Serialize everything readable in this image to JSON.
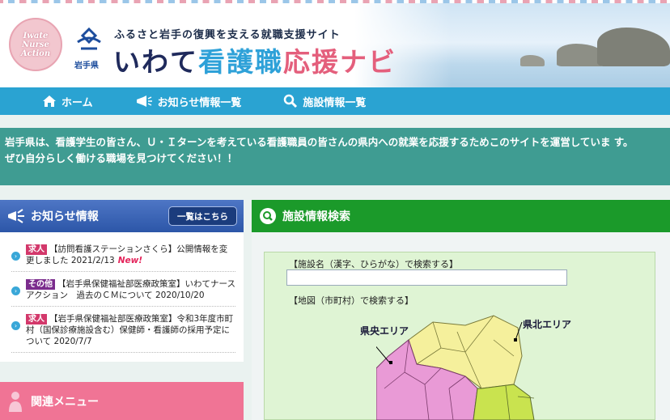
{
  "header": {
    "badge_text": "Iwate\nNurse\nAction",
    "pref_name": "岩手県",
    "tagline": "ふるさと岩手の復興を支える就職支援サイト",
    "title_part1": "いわて",
    "title_part2": "看護職",
    "title_part3": "応援ナビ"
  },
  "nav": {
    "home": "ホーム",
    "news_list": "お知らせ情報一覧",
    "facility_list": "施設情報一覧"
  },
  "intro": {
    "line1": "岩手県は、看護学生の皆さん、Ｕ・Ｉターンを考えている看護職員の皆さんの県内への就業を応援するためこのサイトを運営していま す。",
    "line2": "ぜひ自分らしく働ける職場を見つけてください！！"
  },
  "news": {
    "heading": "お知らせ情報",
    "more": "一覧はこちら",
    "items": [
      {
        "tag": "求人",
        "text": "【訪問看護ステーションさくら】公開情報を変更しました 2021/2/13",
        "new": "New!"
      },
      {
        "tag": "その他",
        "text": "【岩手県保健福祉部医療政策室】いわてナースアクション　過去のＣＭについて 2020/10/20"
      },
      {
        "tag": "求人",
        "text": "【岩手県保健福祉部医療政策室】令和3年度市町村（国保診療施設含む）保健師・看護師の採用予定について 2020/7/7"
      }
    ]
  },
  "related": {
    "heading": "関連メニュー"
  },
  "facility_search": {
    "heading": "施設情報検索",
    "name_label": "【施設名（漢字、ひらがな）で検索する】",
    "name_value": "",
    "map_label": "【地図（市町村）で検索する】",
    "area_central": "県央エリア",
    "area_north": "県北エリア"
  },
  "colors": {
    "nav": "#2aa3d2",
    "intro": "#3f9c92",
    "news_head": "#2c56a8",
    "search_head": "#1b9a2a",
    "related": "#f07495",
    "map_pink": "#e99ad6",
    "map_yellow": "#f5f09c",
    "map_green": "#c9e34f"
  },
  "icons": [
    "home-icon",
    "megaphone-icon",
    "search-icon",
    "person-icon"
  ]
}
